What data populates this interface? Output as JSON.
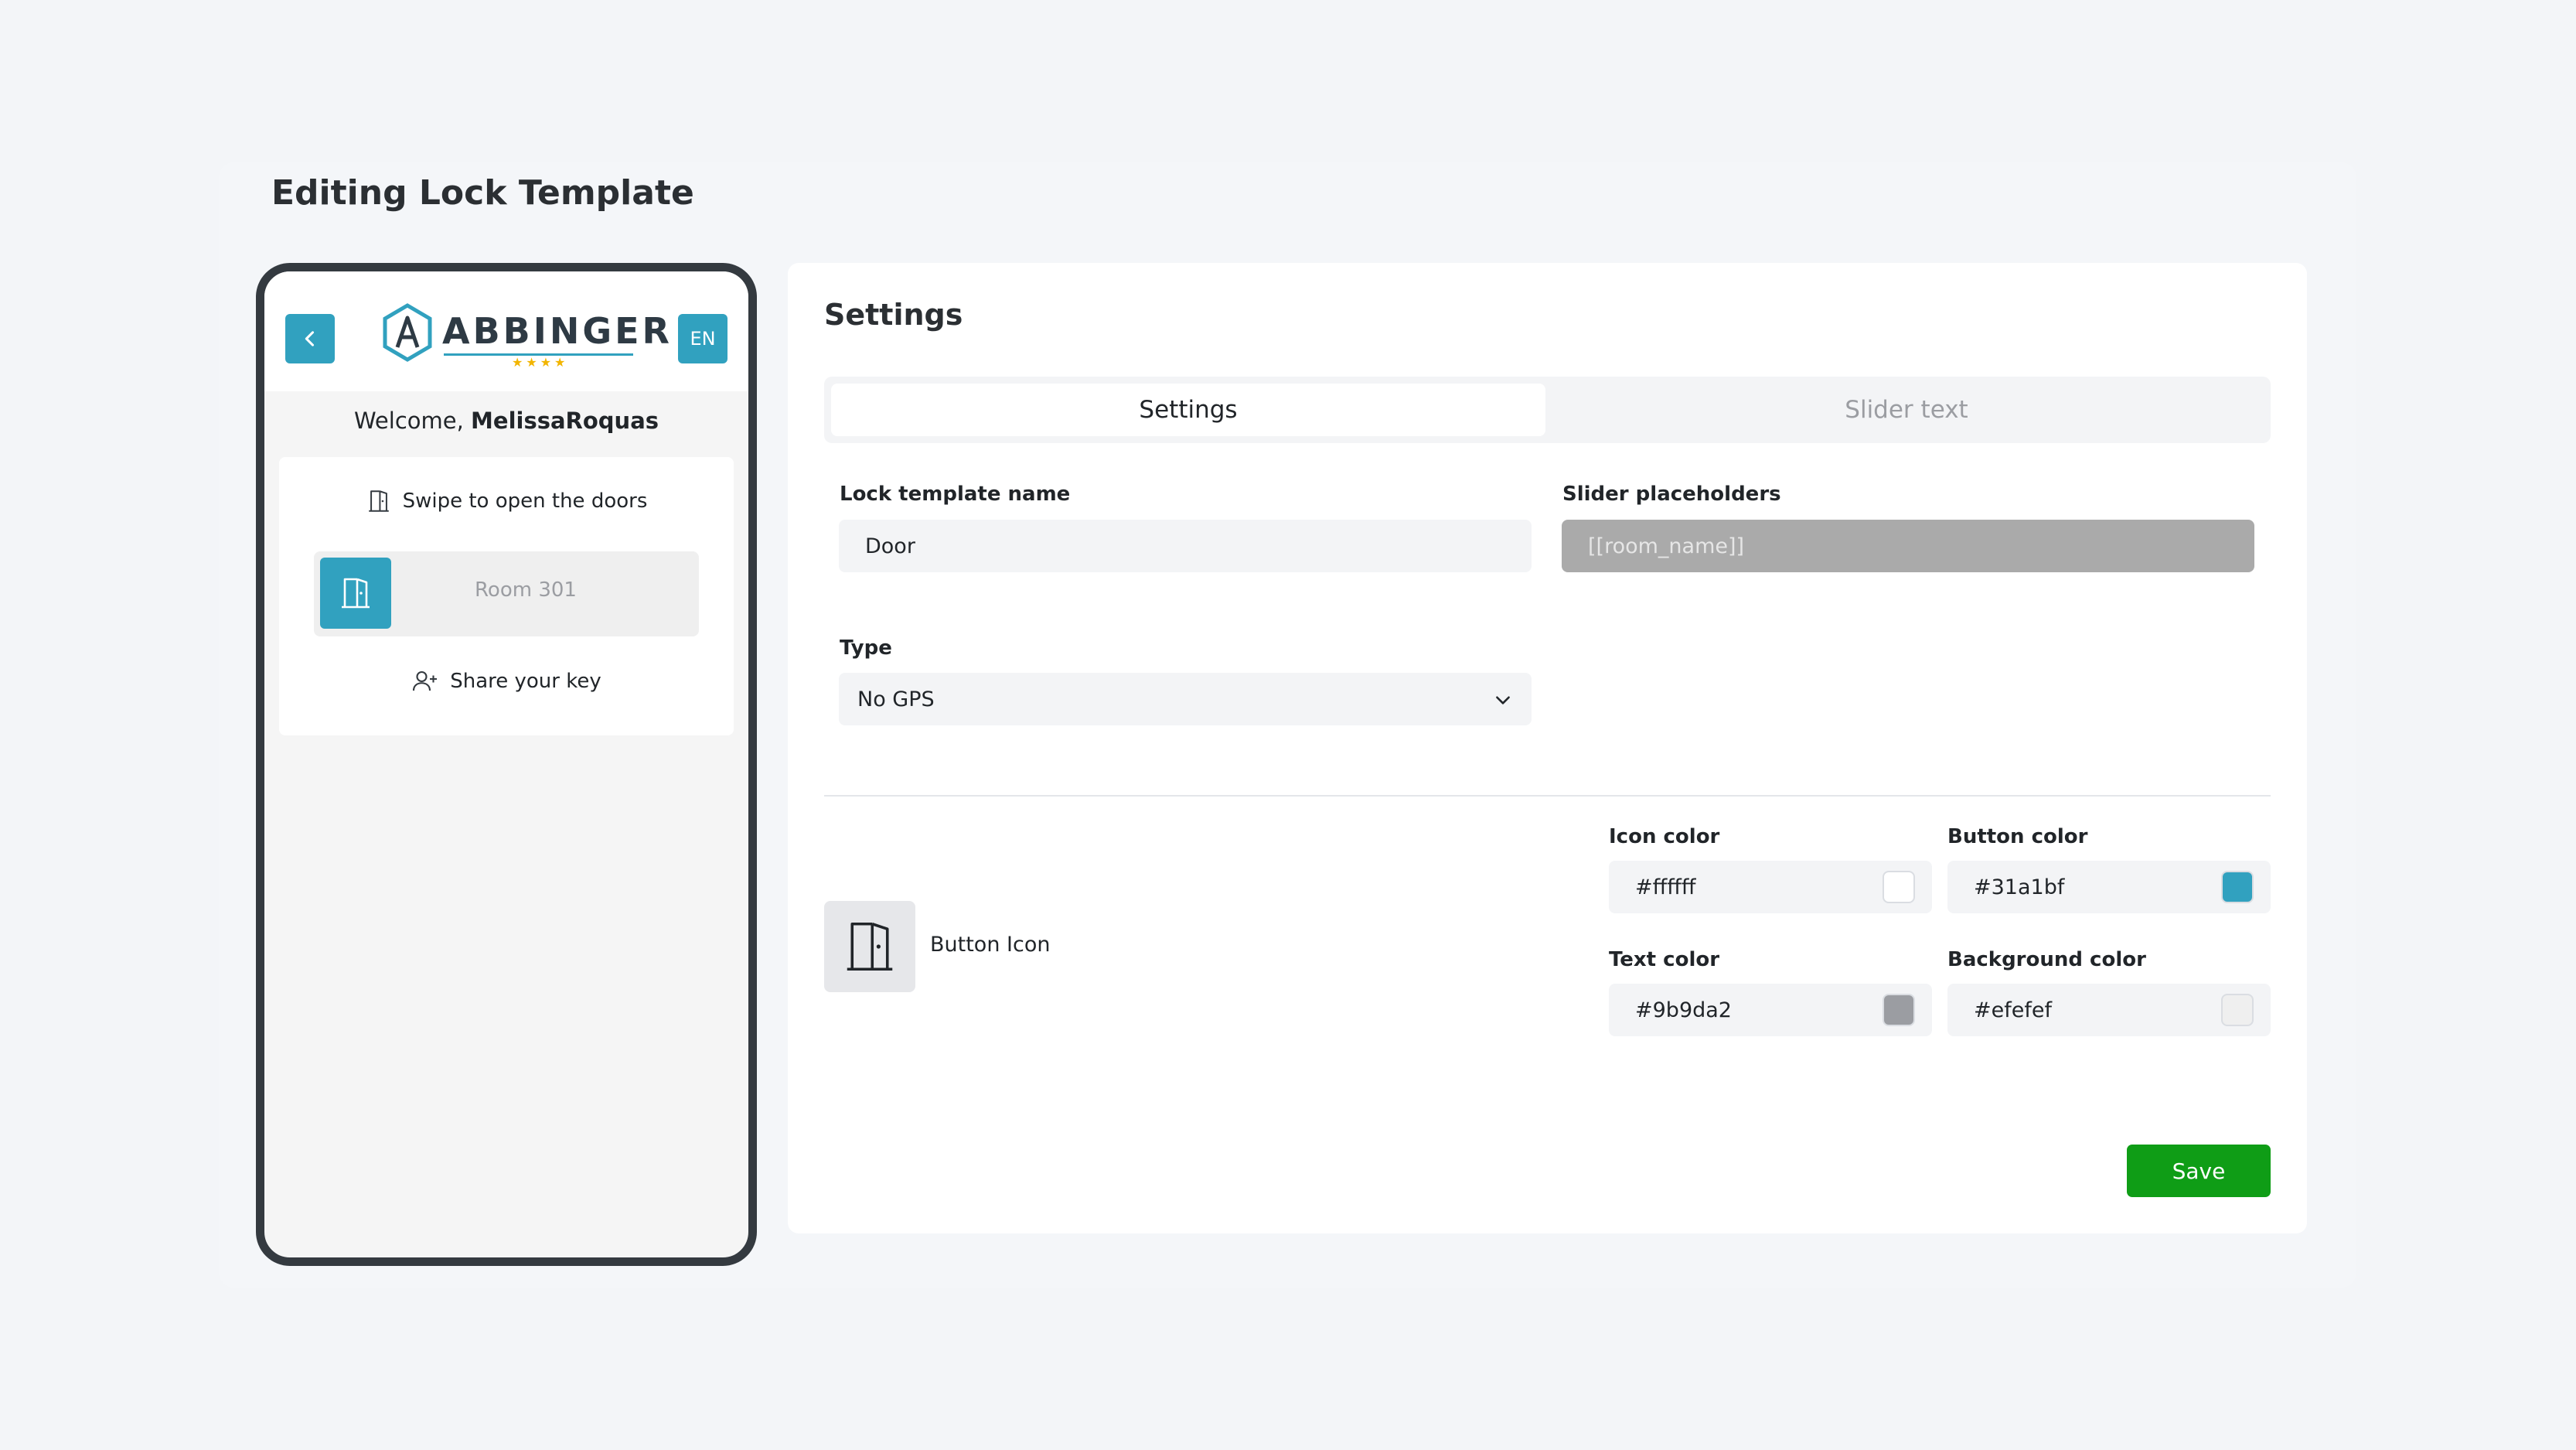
{
  "page": {
    "title": "Editing Lock Template"
  },
  "phone": {
    "lang": "EN",
    "logo_text": "ABBINGER",
    "logo_stars": "★★★★",
    "welcome_prefix": "Welcome, ",
    "welcome_user": "MelissaRoquas",
    "swipe_text": "Swipe to open the doors",
    "room_text": "Room 301",
    "share_text": "Share your key"
  },
  "settings": {
    "title": "Settings",
    "tabs": [
      {
        "label": "Settings",
        "active": true
      },
      {
        "label": "Slider text",
        "active": false
      }
    ],
    "lock_template_name": {
      "label": "Lock template name",
      "value": "Door"
    },
    "slider_placeholders": {
      "label": "Slider placeholders",
      "value": "[[room_name]]"
    },
    "type": {
      "label": "Type",
      "value": "No GPS"
    },
    "button_icon_label": "Button Icon",
    "colors": {
      "icon_color": {
        "label": "Icon color",
        "value": "#ffffff"
      },
      "button_color": {
        "label": "Button color",
        "value": "#31a1bf"
      },
      "text_color": {
        "label": "Text color",
        "value": "#9b9da2"
      },
      "background_color": {
        "label": "Background color",
        "value": "#efefef"
      }
    },
    "save_label": "Save"
  },
  "theme": {
    "accent": "#31a1bf",
    "save_green": "#0f9d16",
    "icons": [
      "chevron-left-icon",
      "door-icon",
      "add-user-icon",
      "chevron-down-icon"
    ]
  }
}
